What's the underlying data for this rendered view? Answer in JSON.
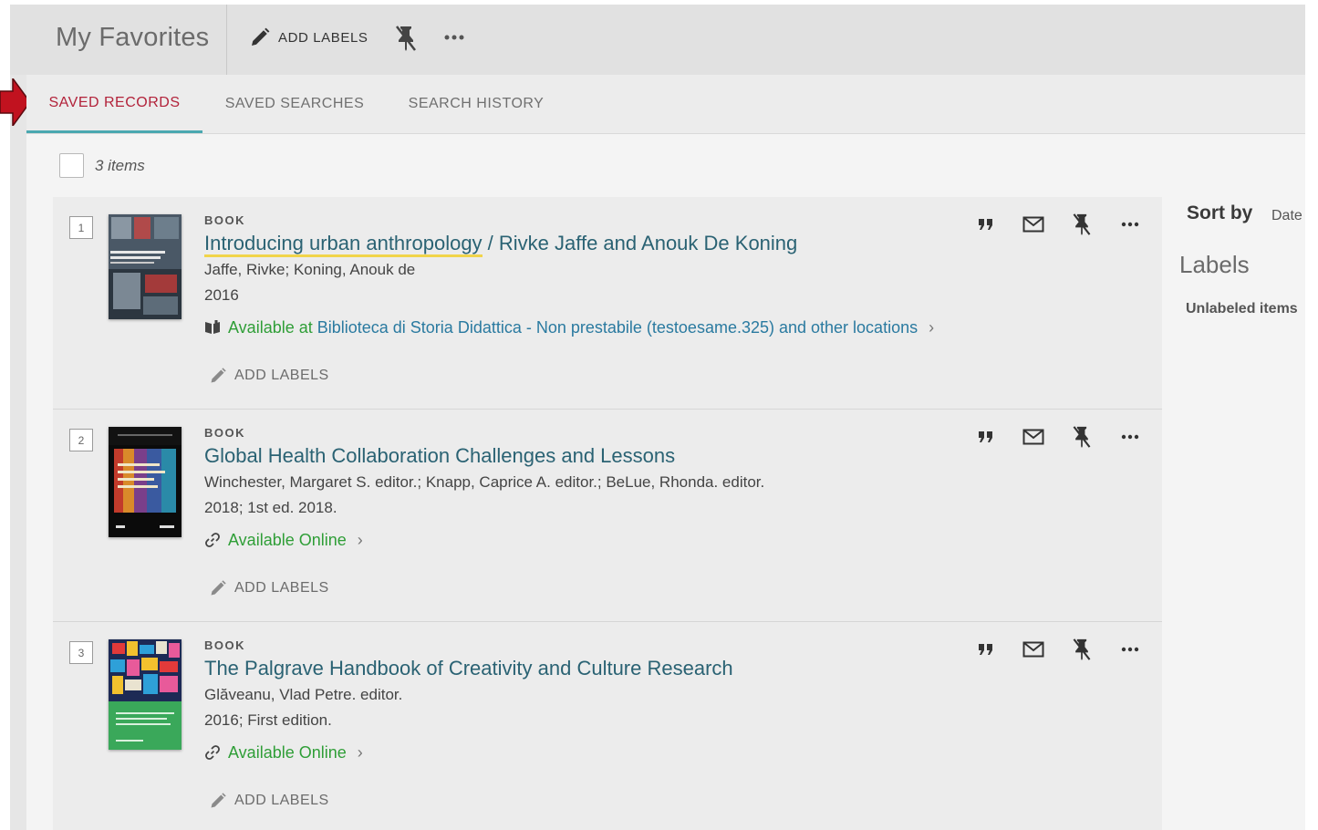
{
  "header": {
    "title": "My Favorites",
    "add_labels": "ADD LABELS",
    "unpin_icon": "unpin-icon",
    "more_icon": "more-icon"
  },
  "tabs": [
    {
      "label": "SAVED RECORDS",
      "active": true
    },
    {
      "label": "SAVED SEARCHES",
      "active": false
    },
    {
      "label": "SEARCH HISTORY",
      "active": false
    }
  ],
  "items_count": "3 items",
  "records": [
    {
      "number": "1",
      "type": "BOOK",
      "title_main": "Introducing urban anthropology",
      "title_rest": " / Rivke Jaffe and Anouk De Koning",
      "authors": "Jaffe, Rivke; Koning, Anouk de",
      "date": "2016",
      "availability_status": "Available at",
      "availability_location": "Biblioteca di Storia  Didattica - Non prestabile (testoesame.325) and other locations",
      "availability_icon": "book-icon",
      "add_labels": "ADD LABELS"
    },
    {
      "number": "2",
      "type": "BOOK",
      "title_main": "Global Health Collaboration Challenges and Lessons",
      "title_rest": "",
      "authors": "Winchester, Margaret S. editor.; Knapp, Caprice A. editor.; BeLue, Rhonda. editor.",
      "date": "2018; 1st ed. 2018.",
      "availability_status": "Available Online",
      "availability_location": "",
      "availability_icon": "link-icon",
      "add_labels": "ADD LABELS"
    },
    {
      "number": "3",
      "type": "BOOK",
      "title_main": "The Palgrave Handbook of Creativity and Culture Research",
      "title_rest": "",
      "authors": "Glăveanu, Vlad Petre. editor.",
      "date": "2016; First edition.",
      "availability_status": "Available Online",
      "availability_location": "",
      "availability_icon": "link-icon",
      "add_labels": "ADD LABELS"
    }
  ],
  "sidebar": {
    "sort_by": "Sort by",
    "sort_value": "Date",
    "labels_heading": "Labels",
    "unlabeled_items": "Unlabeled items"
  },
  "colors": {
    "active_tab": "#b2223a",
    "tab_underline": "#4aa8b0",
    "title_link": "#2a6273",
    "available": "#2f9e37",
    "location_link": "#2a7aa0",
    "title_highlight": "#f1d44a"
  }
}
